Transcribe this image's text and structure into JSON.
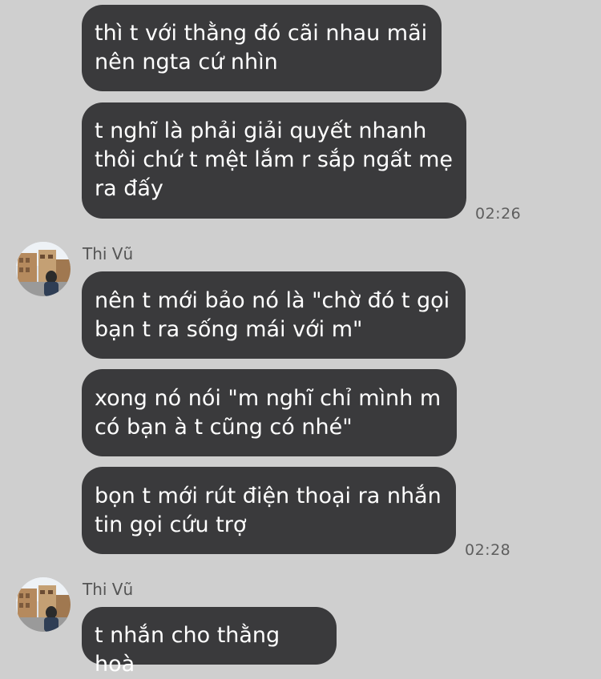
{
  "conversation": {
    "block1": {
      "messages": [
        "thì t với thằng đó cãi nhau mãi\nnên ngta cứ nhìn",
        "t nghĩ là phải giải quyết nhanh\nthôi chứ t mệt lắm r sắp ngất mẹ\nra đấy"
      ],
      "time": "02:26"
    },
    "block2": {
      "sender": "Thi Vũ",
      "avatar_icon": "profile-photo-person-street",
      "messages": [
        "nên t mới bảo nó là \"chờ đó t gọi\nbạn t ra sống mái với m\"",
        "xong nó nói \"m nghĩ chỉ mình m\ncó bạn à t cũng có nhé\"",
        "bọn t mới rút điện thoại ra nhắn\ntin gọi cứu trợ"
      ],
      "time": "02:28"
    },
    "block3": {
      "sender": "Thi Vũ",
      "avatar_icon": "profile-photo-person-street",
      "messages": [
        "t nhắn cho thằng hoà"
      ]
    }
  },
  "colors": {
    "background": "#cfcfcf",
    "bubble": "#3a3a3c",
    "bubble_text": "#ffffff",
    "meta_text": "#5e5e5e"
  }
}
